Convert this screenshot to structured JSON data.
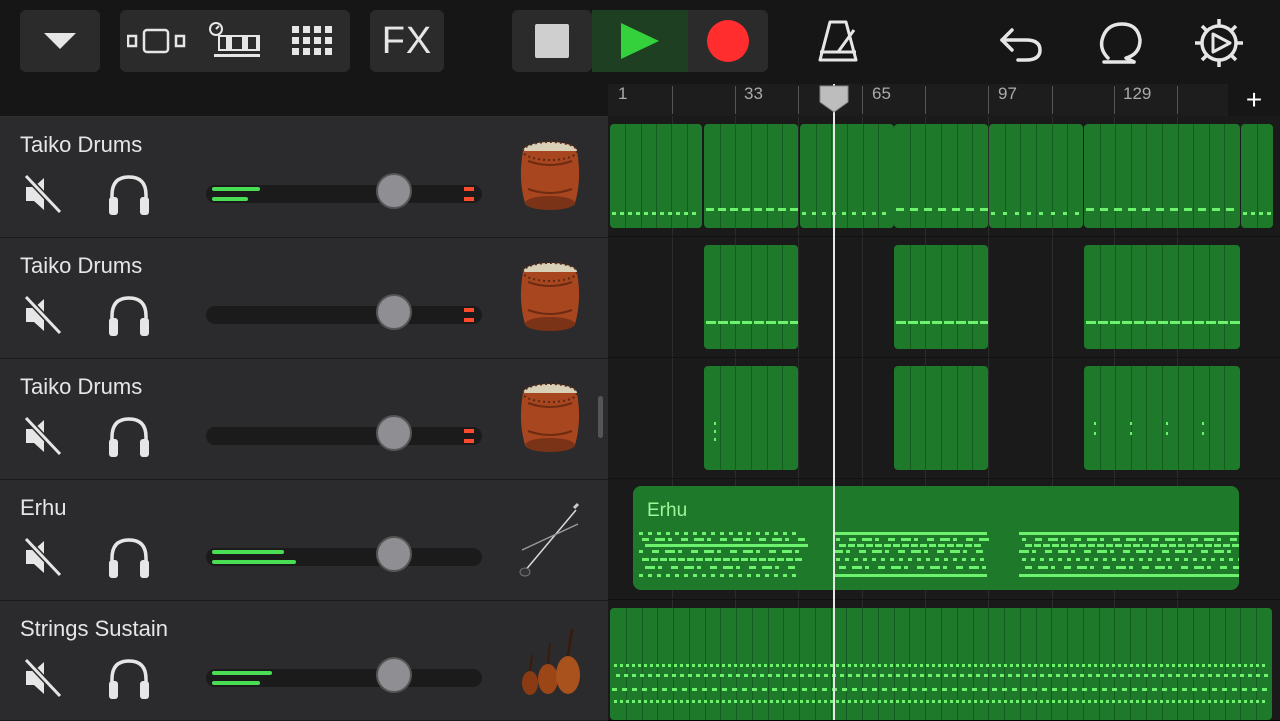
{
  "toolbar": {
    "fx_label": "FX"
  },
  "ruler": {
    "bar_labels": [
      "1",
      "33",
      "65",
      "97",
      "129"
    ],
    "add_label": "+"
  },
  "tracks": [
    {
      "name": "Taiko Drums",
      "icon": "taiko-drum-icon"
    },
    {
      "name": "Taiko Drums",
      "icon": "taiko-drum-icon"
    },
    {
      "name": "Taiko Drums",
      "icon": "taiko-drum-icon"
    },
    {
      "name": "Erhu",
      "icon": "erhu-icon",
      "region_label": "Erhu"
    },
    {
      "name": "Strings Sustain",
      "icon": "strings-icon"
    }
  ],
  "colors": {
    "region_green": "#1e7a2a",
    "note_green": "#6cf26c",
    "play_green": "#34d13d",
    "record_red": "#ff2d2d",
    "meter_green": "#4ade55",
    "peak_orange": "#ff4b2b"
  }
}
